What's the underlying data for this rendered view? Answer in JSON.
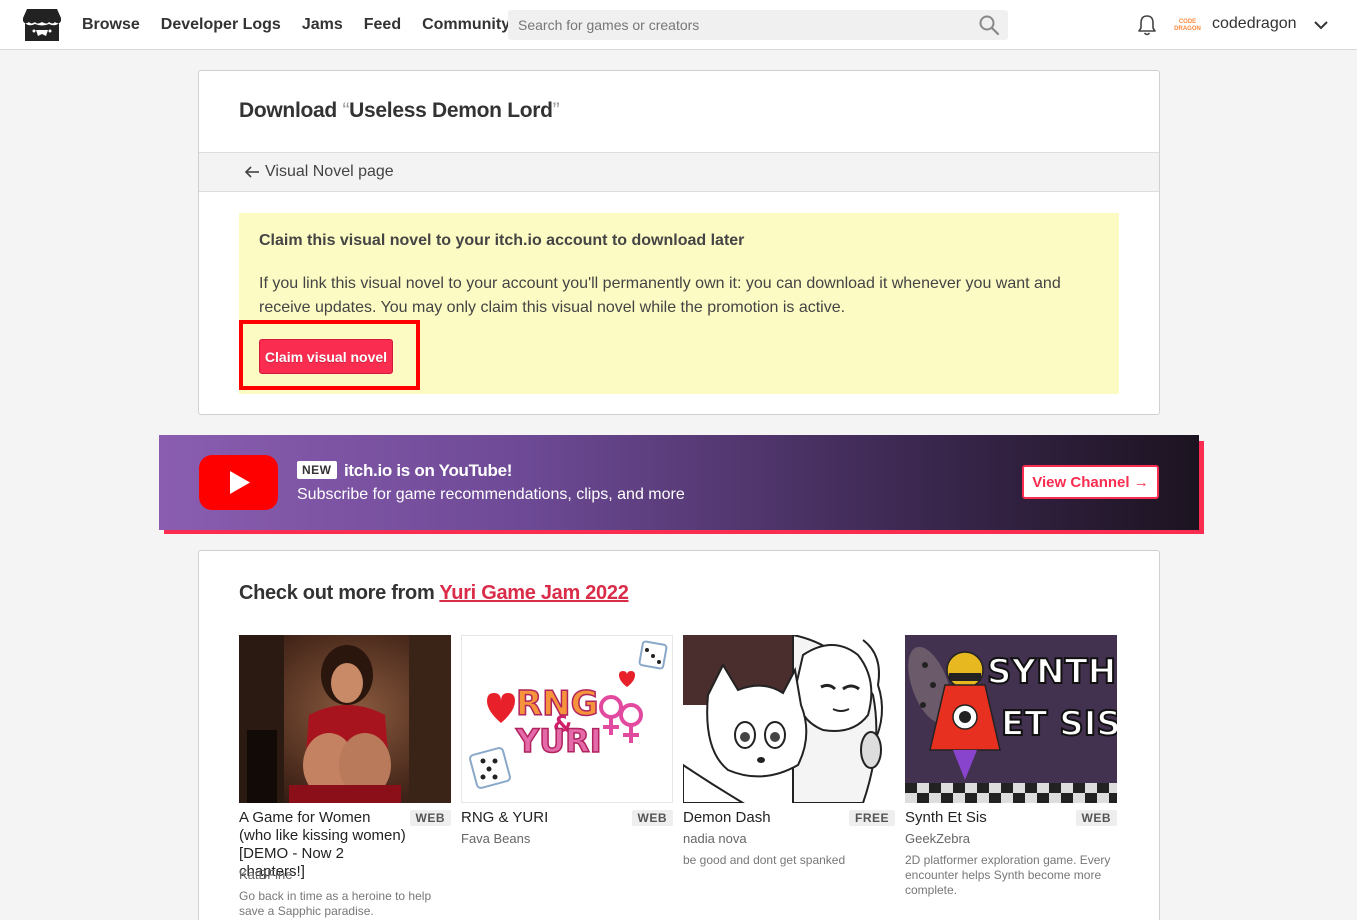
{
  "header": {
    "nav": [
      "Browse",
      "Developer Logs",
      "Jams",
      "Feed",
      "Community"
    ],
    "search_placeholder": "Search for games or creators",
    "avatar_text": [
      "CODE",
      "DRAGON"
    ],
    "username": "codedragon"
  },
  "download": {
    "title_prefix": "Download ",
    "open_quote": "“",
    "game_name": "Useless Demon Lord",
    "close_quote": "”",
    "back_link": "Visual Novel page",
    "claim_title": "Claim this visual novel to your itch.io account to download later",
    "claim_text": "If you link this visual novel to your account you'll permanently own it: you can download it whenever you want and receive updates. You may only claim this visual novel while the promotion is active.",
    "claim_button": "Claim visual novel"
  },
  "youtube": {
    "badge": "NEW",
    "title": "itch.io is on YouTube!",
    "subtitle": "Subscribe for game recommendations, clips, and more",
    "button": "View Channel →"
  },
  "more": {
    "heading_prefix": "Check out more from ",
    "jam_name": "Yuri Game Jam 2022",
    "games": [
      {
        "title": "A Game for Women (who like kissing women) [DEMO - Now 2 chapters!]",
        "tag": "WEB",
        "author": "KatBFine",
        "desc": "Go back in time as a heroine to help save a Sapphic paradise."
      },
      {
        "title": "RNG & YURI",
        "tag": "WEB",
        "author": "Fava Beans",
        "desc": ""
      },
      {
        "title": "Demon Dash",
        "tag": "FREE",
        "author": "nadia nova",
        "desc": "be good and dont get spanked"
      },
      {
        "title": "Synth Et Sis",
        "tag": "WEB",
        "author": "GeekZebra",
        "desc": "2D platformer exploration game. Every encounter helps Synth become more complete."
      }
    ],
    "thumb_art": {
      "rng_letters": "RNG",
      "rng_amp": "&",
      "rng_yuri": "YURI",
      "synth_line1": "SYNTH",
      "synth_line2": "ET SIS"
    }
  },
  "colors": {
    "accent": "#fa2d50",
    "claim_bg": "#fcfbc4",
    "highlight": "#ff0000"
  }
}
